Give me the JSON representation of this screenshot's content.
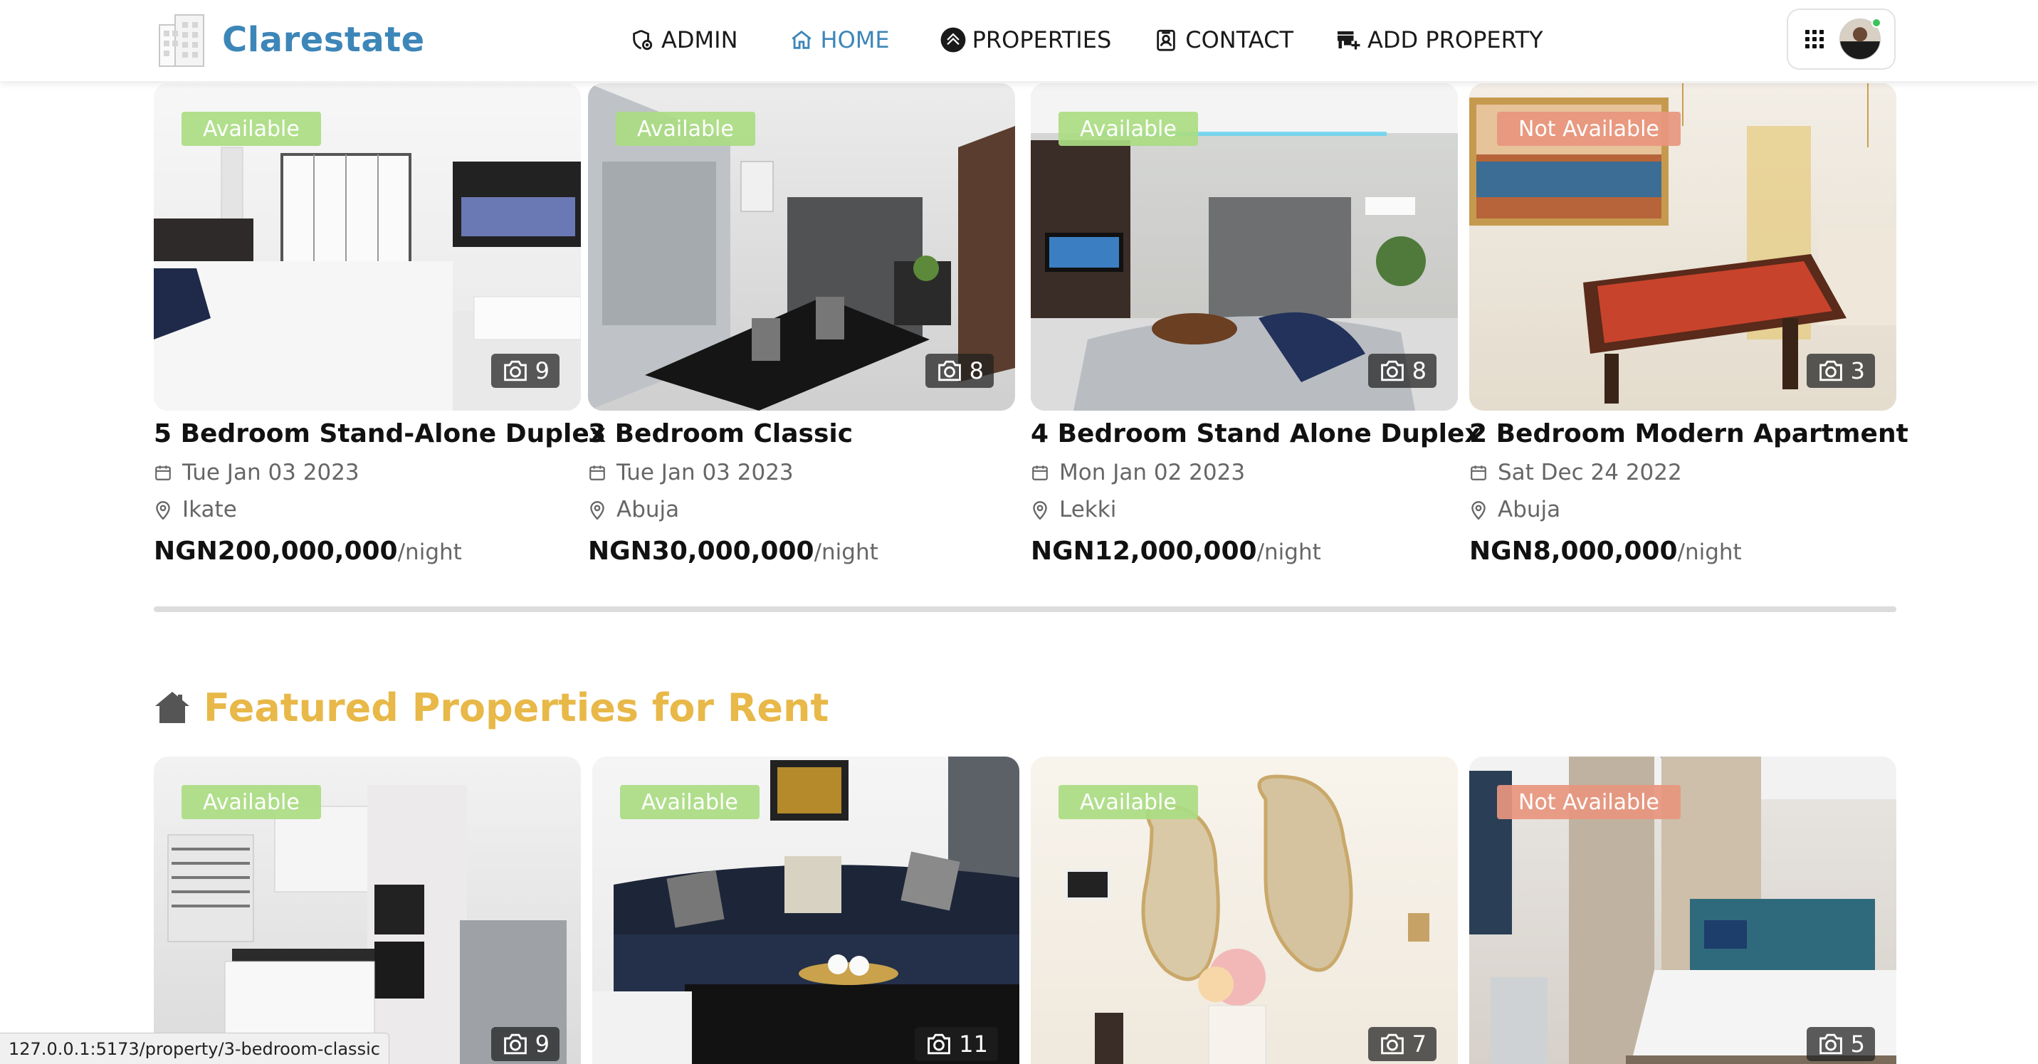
{
  "brand": {
    "name": "Clarestate",
    "logo_icon": "building-logo-icon",
    "color": "#3d86b8"
  },
  "nav": {
    "items": [
      {
        "label": "ADMIN",
        "icon": "admin-shield-icon",
        "active": false
      },
      {
        "label": "HOME",
        "icon": "home-icon",
        "active": true
      },
      {
        "label": "PROPERTIES",
        "icon": "properties-icon",
        "active": false
      },
      {
        "label": "CONTACT",
        "icon": "contact-card-icon",
        "active": false
      },
      {
        "label": "ADD PROPERTY",
        "icon": "add-store-icon",
        "active": false
      }
    ],
    "active_color": "#3d86b8"
  },
  "user_menu": {
    "apps_icon": "grid-icon",
    "avatar": "user-avatar",
    "online": true
  },
  "top_properties": [
    {
      "title": "5 Bedroom Stand-Alone Duplex",
      "status": "Available",
      "photos": "9",
      "date": "Tue Jan 03 2023",
      "location": "Ikate",
      "price": "NGN200,000,000",
      "per": "/night"
    },
    {
      "title": "3 Bedroom Classic",
      "status": "Available",
      "photos": "8",
      "date": "Tue Jan 03 2023",
      "location": "Abuja",
      "price": "NGN30,000,000",
      "per": "/night"
    },
    {
      "title": "4 Bedroom Stand Alone Duplex",
      "status": "Available",
      "photos": "8",
      "date": "Mon Jan 02 2023",
      "location": "Lekki",
      "price": "NGN12,000,000",
      "per": "/night"
    },
    {
      "title": "2 Bedroom Modern Apartment",
      "status": "Not Available",
      "photos": "3",
      "date": "Sat Dec 24 2022",
      "location": "Abuja",
      "price": "NGN8,000,000",
      "per": "/night"
    }
  ],
  "featured": {
    "heading": "Featured Properties for Rent",
    "heading_color": "#e8b848",
    "items": [
      {
        "status": "Available",
        "photos": "9"
      },
      {
        "status": "Available",
        "photos": "11"
      },
      {
        "status": "Available",
        "photos": "7"
      },
      {
        "status": "Not Available",
        "photos": "5"
      }
    ]
  },
  "status_bar": {
    "url": "127.0.0.1:5173/property/3-bedroom-classic"
  },
  "colors": {
    "available": "#aadc82",
    "not_available": "#e8967e"
  }
}
